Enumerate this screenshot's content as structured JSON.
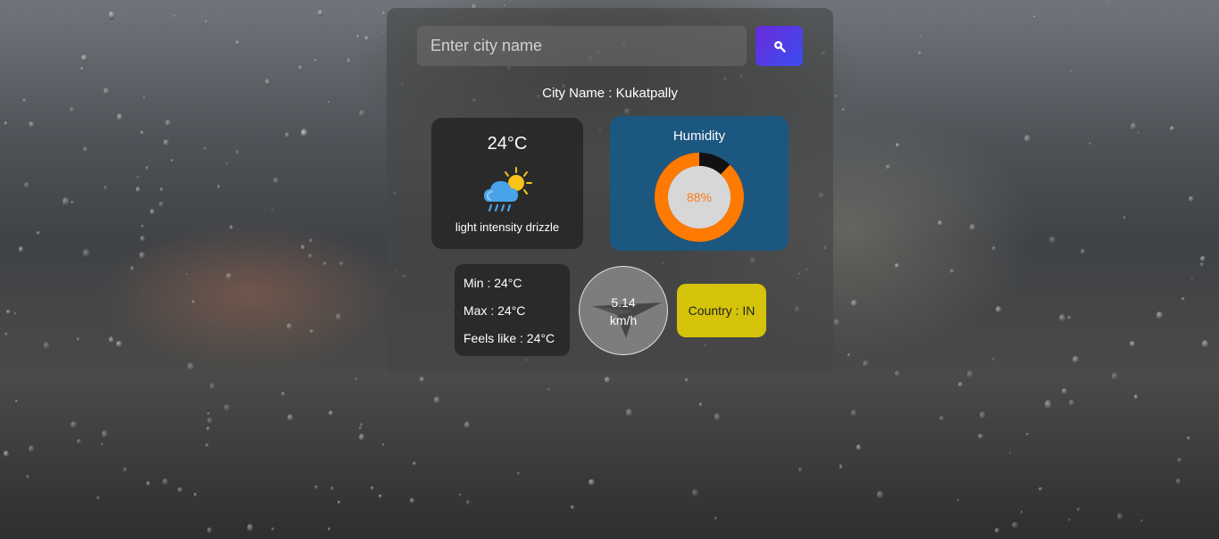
{
  "search": {
    "placeholder": "Enter city name",
    "value": "",
    "button_icon": "search-icon"
  },
  "city": {
    "label": "City Name : Kukatpally"
  },
  "weather": {
    "temperature": "24°C",
    "description": "light intensity drizzle",
    "icon": "sun-behind-rain-cloud-icon"
  },
  "humidity": {
    "title": "Humidity",
    "value_label": "88%",
    "value": 88,
    "ring_color": "#ff7a00",
    "track_color": "#111111"
  },
  "temps": {
    "min": "Min : 24°C",
    "max": "Max : 24°C",
    "feels_like": "Feels like : 24°C"
  },
  "wind": {
    "speed": "5.14",
    "unit": "km/h",
    "icon": "compass-needle-icon"
  },
  "country": {
    "label": "Country : IN"
  },
  "colors": {
    "search_button": "#4f3be6",
    "humidity_panel": "#1c5780",
    "country_panel": "#d4c30a"
  }
}
